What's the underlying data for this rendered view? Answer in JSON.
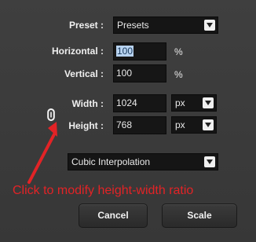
{
  "preset": {
    "label": "Preset :",
    "value": "Presets"
  },
  "horizontal": {
    "label": "Horizontal :",
    "value": "100",
    "unit": "%"
  },
  "vertical": {
    "label": "Vertical :",
    "value": "100",
    "unit": "%"
  },
  "width": {
    "label": "Width :",
    "value": "1024",
    "unit": "px"
  },
  "height": {
    "label": "Height :",
    "value": "768",
    "unit": "px"
  },
  "interpolation": {
    "value": "Cubic Interpolation"
  },
  "annotation": {
    "text": "Click to modify height-width ratio"
  },
  "buttons": {
    "cancel": "Cancel",
    "scale": "Scale"
  },
  "icons": {
    "link": "link-icon",
    "dropdown": "chevron-down-icon",
    "annotation_arrow": "arrow-icon"
  },
  "colors": {
    "annotation": "#e22326",
    "selection": "#b7d2ef",
    "background": "#3b3b3b"
  }
}
